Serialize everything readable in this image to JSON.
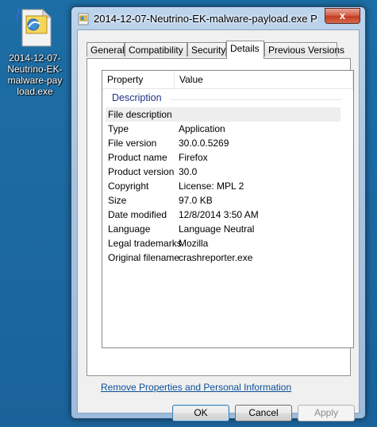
{
  "desktop": {
    "icon_label": "2014-12-07-Neutrino-EK-malware-payload.exe",
    "icon_label_lines": [
      "2014-12-07-",
      "Neutrino-EK-",
      "malware-pay",
      "load.exe"
    ]
  },
  "window": {
    "title": "2014-12-07-Neutrino-EK-malware-payload.exe Prope...",
    "close_label": "x",
    "tabs": [
      {
        "label": "General"
      },
      {
        "label": "Compatibility"
      },
      {
        "label": "Security"
      },
      {
        "label": "Details"
      },
      {
        "label": "Previous Versions"
      }
    ],
    "active_tab": "Details"
  },
  "details": {
    "columns": {
      "property": "Property",
      "value": "Value"
    },
    "group": "Description",
    "rows": [
      {
        "property": "File description",
        "value": ""
      },
      {
        "property": "Type",
        "value": "Application"
      },
      {
        "property": "File version",
        "value": "30.0.0.5269"
      },
      {
        "property": "Product name",
        "value": "Firefox"
      },
      {
        "property": "Product version",
        "value": "30.0"
      },
      {
        "property": "Copyright",
        "value": "License: MPL 2"
      },
      {
        "property": "Size",
        "value": "97.0 KB"
      },
      {
        "property": "Date modified",
        "value": "12/8/2014 3:50 AM"
      },
      {
        "property": "Language",
        "value": "Language Neutral"
      },
      {
        "property": "Legal trademarks",
        "value": "Mozilla"
      },
      {
        "property": "Original filename",
        "value": "crashreporter.exe"
      }
    ]
  },
  "remove_link": "Remove Properties and Personal Information",
  "buttons": {
    "ok": "OK",
    "cancel": "Cancel",
    "apply": "Apply"
  },
  "colors": {
    "desktop": "#1d6ea6",
    "link": "#0b4f9a",
    "group_header": "#1e3287"
  }
}
